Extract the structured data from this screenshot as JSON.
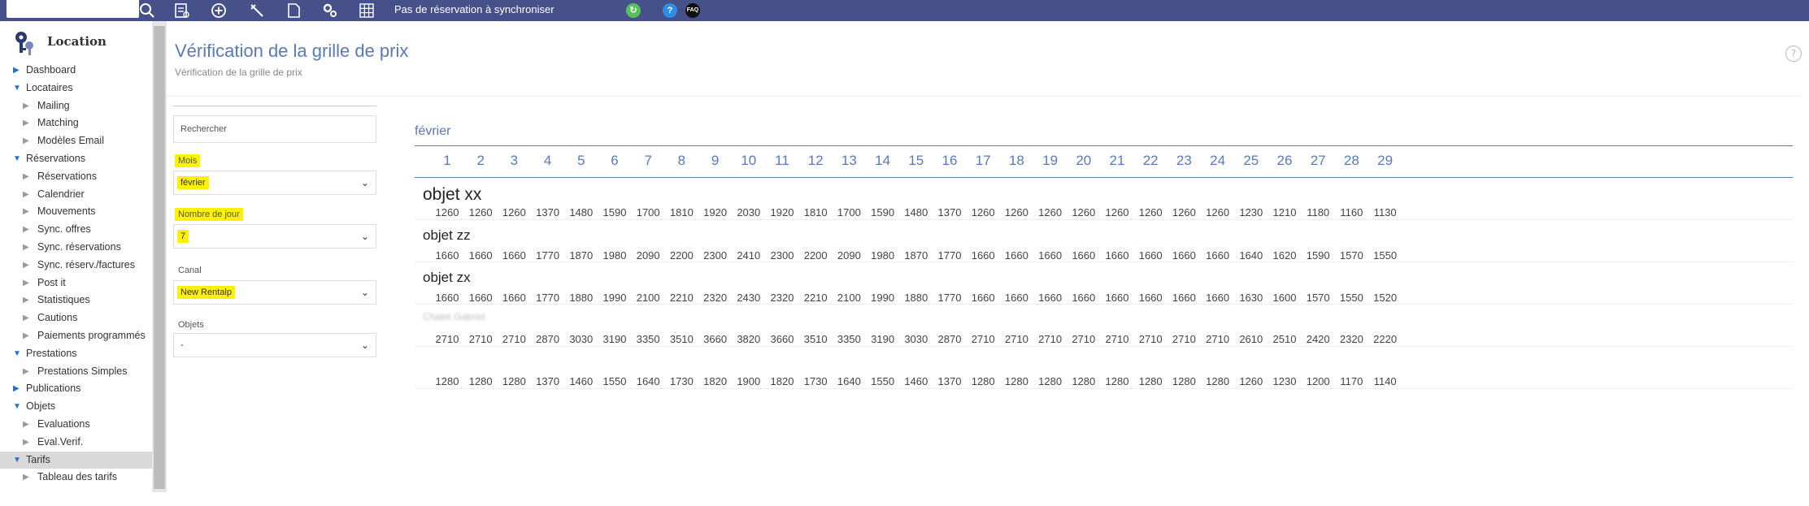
{
  "topbar": {
    "status": "Pas de réservation à synchroniser",
    "icons": [
      "search-icon",
      "list-icon",
      "add-circle-icon",
      "tools-icon",
      "document-icon",
      "gears-icon",
      "grid-icon",
      "sync-icon",
      "help-icon",
      "faq-icon"
    ],
    "help_label": "?",
    "faq_label": "FAQ"
  },
  "sidebar": {
    "title": "Location",
    "items": [
      {
        "label": "Dashboard",
        "level": "top",
        "icon": "triangle-right-icon"
      },
      {
        "label": "Locataires",
        "level": "top",
        "icon": "triangle-down-icon"
      },
      {
        "label": "Mailing",
        "level": "sub",
        "icon": "triangle-right-icon"
      },
      {
        "label": "Matching",
        "level": "sub",
        "icon": "triangle-right-icon"
      },
      {
        "label": "Modèles Email",
        "level": "sub",
        "icon": "triangle-right-icon"
      },
      {
        "label": "Réservations",
        "level": "top",
        "icon": "triangle-down-icon"
      },
      {
        "label": "Réservations",
        "level": "sub",
        "icon": "triangle-right-icon"
      },
      {
        "label": "Calendrier",
        "level": "sub",
        "icon": "triangle-right-icon"
      },
      {
        "label": "Mouvements",
        "level": "sub",
        "icon": "triangle-right-icon"
      },
      {
        "label": "Sync. offres",
        "level": "sub",
        "icon": "triangle-right-icon"
      },
      {
        "label": "Sync. réservations",
        "level": "sub",
        "icon": "triangle-right-icon"
      },
      {
        "label": "Sync. réserv./factures",
        "level": "sub",
        "icon": "triangle-right-icon"
      },
      {
        "label": "Post it",
        "level": "sub",
        "icon": "triangle-right-icon"
      },
      {
        "label": "Statistiques",
        "level": "sub",
        "icon": "triangle-right-icon"
      },
      {
        "label": "Cautions",
        "level": "sub",
        "icon": "triangle-right-icon"
      },
      {
        "label": "Paiements programmés",
        "level": "sub",
        "icon": "triangle-right-icon"
      },
      {
        "label": "Prestations",
        "level": "top",
        "icon": "triangle-down-icon"
      },
      {
        "label": "Prestations Simples",
        "level": "sub",
        "icon": "triangle-right-icon"
      },
      {
        "label": "Publications",
        "level": "top",
        "icon": "triangle-right-icon"
      },
      {
        "label": "Objets",
        "level": "top",
        "icon": "triangle-down-icon"
      },
      {
        "label": "Evaluations",
        "level": "sub",
        "icon": "triangle-right-icon"
      },
      {
        "label": "Eval.Verif.",
        "level": "sub",
        "icon": "triangle-right-icon"
      },
      {
        "label": "Tarifs",
        "level": "top",
        "icon": "triangle-down-icon",
        "active": true
      },
      {
        "label": "Tableau des tarifs",
        "level": "sub",
        "icon": "triangle-right-icon"
      }
    ]
  },
  "header": {
    "title": "Vérification de la grille de prix",
    "subtitle": "Vérification de la grille de prix"
  },
  "filters": {
    "search_placeholder": "Rechercher",
    "mois_label": "Mois",
    "mois_value": "février",
    "jours_label": "Nombre de jour",
    "jours_value": "7",
    "canal_label": "Canal",
    "canal_value": "New Rentalp",
    "objets_label": "Objets",
    "objets_value": "-"
  },
  "grid": {
    "month": "février",
    "days": [
      "1",
      "2",
      "3",
      "4",
      "5",
      "6",
      "7",
      "8",
      "9",
      "10",
      "11",
      "12",
      "13",
      "14",
      "15",
      "16",
      "17",
      "18",
      "19",
      "20",
      "21",
      "22",
      "23",
      "24",
      "25",
      "26",
      "27",
      "28",
      "29"
    ],
    "objects": [
      {
        "name": "objet xx",
        "style": "big",
        "prices": [
          1260,
          1260,
          1260,
          1370,
          1480,
          1590,
          1700,
          1810,
          1920,
          2030,
          1920,
          1810,
          1700,
          1590,
          1480,
          1370,
          1260,
          1260,
          1260,
          1260,
          1260,
          1260,
          1260,
          1260,
          1230,
          1210,
          1180,
          1160,
          1130
        ]
      },
      {
        "name": "objet zz",
        "style": "normal",
        "prices": [
          1660,
          1660,
          1660,
          1770,
          1870,
          1980,
          2090,
          2200,
          2300,
          2410,
          2300,
          2200,
          2090,
          1980,
          1870,
          1770,
          1660,
          1660,
          1660,
          1660,
          1660,
          1660,
          1660,
          1660,
          1640,
          1620,
          1590,
          1570,
          1550
        ]
      },
      {
        "name": "objet zx",
        "style": "normal",
        "prices": [
          1660,
          1660,
          1660,
          1770,
          1880,
          1990,
          2100,
          2210,
          2320,
          2430,
          2320,
          2210,
          2100,
          1990,
          1880,
          1770,
          1660,
          1660,
          1660,
          1660,
          1660,
          1660,
          1660,
          1660,
          1630,
          1600,
          1570,
          1550,
          1520
        ]
      },
      {
        "name": "Chalet Gabriel",
        "style": "blur",
        "prices": [
          2710,
          2710,
          2710,
          2870,
          3030,
          3190,
          3350,
          3510,
          3660,
          3820,
          3660,
          3510,
          3350,
          3190,
          3030,
          2870,
          2710,
          2710,
          2710,
          2710,
          2710,
          2710,
          2710,
          2710,
          2610,
          2510,
          2420,
          2320,
          2220
        ]
      },
      {
        "name": "",
        "style": "blur",
        "prices": [
          1280,
          1280,
          1280,
          1370,
          1460,
          1550,
          1640,
          1730,
          1820,
          1900,
          1820,
          1730,
          1640,
          1550,
          1460,
          1370,
          1280,
          1280,
          1280,
          1280,
          1280,
          1280,
          1280,
          1280,
          1260,
          1230,
          1200,
          1170,
          1140
        ]
      }
    ]
  }
}
